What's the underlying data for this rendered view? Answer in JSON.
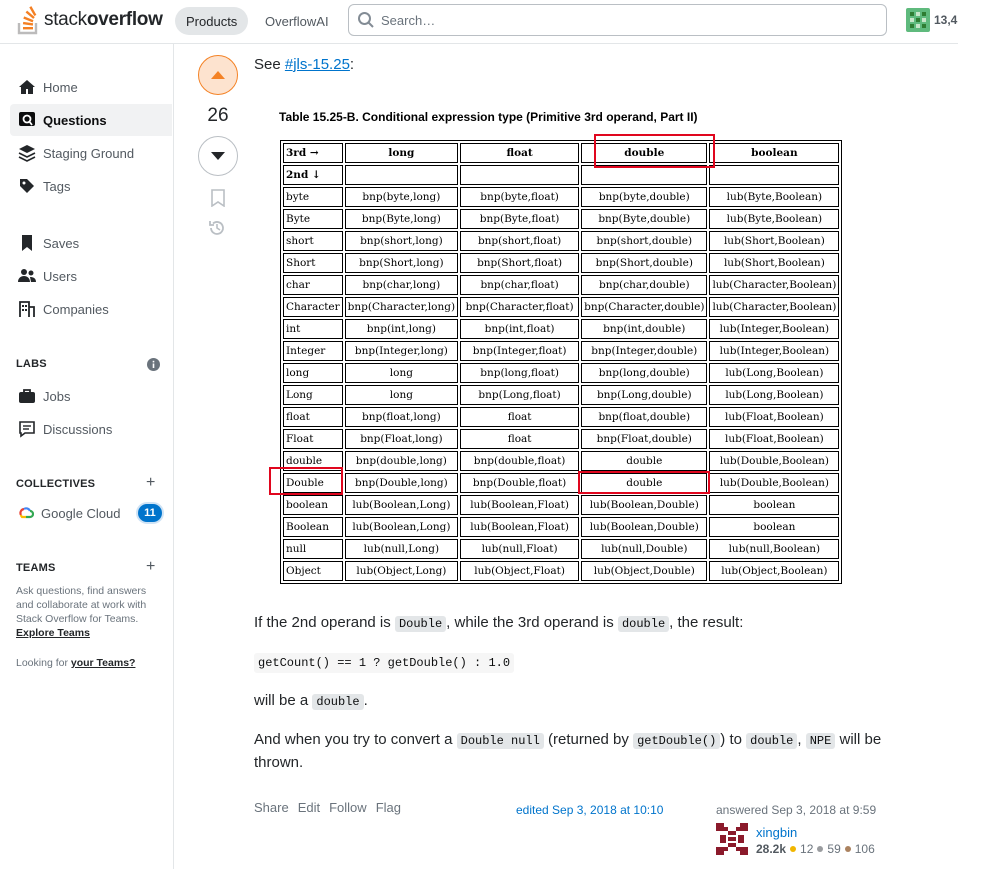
{
  "header": {
    "logo_prefix": "stack",
    "logo_suffix": "overflow",
    "nav_products": "Products",
    "nav_overflowai": "OverflowAI",
    "search_placeholder": "Search…",
    "user_rep": "13,4"
  },
  "sidebar": {
    "items": [
      {
        "label": "Home",
        "icon": "home-icon"
      },
      {
        "label": "Questions",
        "icon": "questions-icon"
      },
      {
        "label": "Staging Ground",
        "icon": "staging-ground-icon"
      },
      {
        "label": "Tags",
        "icon": "tag-icon"
      },
      {
        "label": "Saves",
        "icon": "bookmark-icon"
      },
      {
        "label": "Users",
        "icon": "users-icon"
      },
      {
        "label": "Companies",
        "icon": "companies-icon"
      }
    ],
    "labs_heading": "LABS",
    "labs_items": [
      {
        "label": "Jobs",
        "icon": "briefcase-icon"
      },
      {
        "label": "Discussions",
        "icon": "discussion-icon"
      }
    ],
    "collectives_heading": "COLLECTIVES",
    "collective": {
      "label": "Google Cloud",
      "count": "11"
    },
    "teams_heading": "TEAMS",
    "teams_text": "Ask questions, find answers and collaborate at work with Stack Overflow for Teams.",
    "teams_link": "Explore Teams",
    "looking_prefix": "Looking for",
    "looking_link": "your Teams?"
  },
  "post": {
    "score": "26",
    "see_prefix": "See",
    "see_link": "#jls-15.25",
    "see_suffix": ":",
    "p1_a": "If the 2nd operand is",
    "p1_code1": "Double",
    "p1_b": ", while the 3rd operand is",
    "p1_code2": "double",
    "p1_c": ", the result:",
    "code_block": "getCount() == 1 ? getDouble() : 1.0",
    "p2_a": "will be a",
    "p2_code": "double",
    "p2_b": ".",
    "p3_a": "And when you try to convert a",
    "p3_code1": "Double null",
    "p3_b": "(returned by",
    "p3_code2": "getDouble()",
    "p3_c": ") to",
    "p3_code3": "double",
    "p3_d": ",",
    "p3_code4": "NPE",
    "p3_e": "will be",
    "p3_f": "thrown.",
    "menu": [
      "Share",
      "Edit",
      "Follow",
      "Flag"
    ],
    "edited": "edited Sep 3, 2018 at 10:10",
    "answered": "answered Sep 3, 2018 at 9:59",
    "user_name": "xingbin",
    "user_rep": "28.2k",
    "gold": "12",
    "silver": "59",
    "bronze": "106"
  },
  "table": {
    "caption": "Table 15.25-B. Conditional expression type (Primitive 3rd operand, Part II)",
    "header": [
      "3rd →",
      "long",
      "float",
      "double",
      "boolean"
    ],
    "subheader": [
      "2nd ↓",
      "",
      "",
      "",
      ""
    ],
    "rows": [
      [
        "byte",
        "bnp(byte,long)",
        "bnp(byte,float)",
        "bnp(byte,double)",
        "lub(Byte,Boolean)"
      ],
      [
        "Byte",
        "bnp(Byte,long)",
        "bnp(Byte,float)",
        "bnp(Byte,double)",
        "lub(Byte,Boolean)"
      ],
      [
        "short",
        "bnp(short,long)",
        "bnp(short,float)",
        "bnp(short,double)",
        "lub(Short,Boolean)"
      ],
      [
        "Short",
        "bnp(Short,long)",
        "bnp(Short,float)",
        "bnp(Short,double)",
        "lub(Short,Boolean)"
      ],
      [
        "char",
        "bnp(char,long)",
        "bnp(char,float)",
        "bnp(char,double)",
        "lub(Character,Boolean)"
      ],
      [
        "Character",
        "bnp(Character,long)",
        "bnp(Character,float)",
        "bnp(Character,double)",
        "lub(Character,Boolean)"
      ],
      [
        "int",
        "bnp(int,long)",
        "bnp(int,float)",
        "bnp(int,double)",
        "lub(Integer,Boolean)"
      ],
      [
        "Integer",
        "bnp(Integer,long)",
        "bnp(Integer,float)",
        "bnp(Integer,double)",
        "lub(Integer,Boolean)"
      ],
      [
        "long",
        "long",
        "bnp(long,float)",
        "bnp(long,double)",
        "lub(Long,Boolean)"
      ],
      [
        "Long",
        "long",
        "bnp(Long,float)",
        "bnp(Long,double)",
        "lub(Long,Boolean)"
      ],
      [
        "float",
        "bnp(float,long)",
        "float",
        "bnp(float,double)",
        "lub(Float,Boolean)"
      ],
      [
        "Float",
        "bnp(Float,long)",
        "float",
        "bnp(Float,double)",
        "lub(Float,Boolean)"
      ],
      [
        "double",
        "bnp(double,long)",
        "bnp(double,float)",
        "double",
        "lub(Double,Boolean)"
      ],
      [
        "Double",
        "bnp(Double,long)",
        "bnp(Double,float)",
        "double",
        "lub(Double,Boolean)"
      ],
      [
        "boolean",
        "lub(Boolean,Long)",
        "lub(Boolean,Float)",
        "lub(Boolean,Double)",
        "boolean"
      ],
      [
        "Boolean",
        "lub(Boolean,Long)",
        "lub(Boolean,Float)",
        "lub(Boolean,Double)",
        "boolean"
      ],
      [
        "null",
        "lub(null,Long)",
        "lub(null,Float)",
        "lub(null,Double)",
        "lub(null,Boolean)"
      ],
      [
        "Object",
        "lub(Object,Long)",
        "lub(Object,Float)",
        "lub(Object,Double)",
        "lub(Object,Boolean)"
      ]
    ]
  },
  "colors": {
    "accent": "#f48225",
    "link": "#0074cc",
    "highlight": "#e0061e"
  }
}
